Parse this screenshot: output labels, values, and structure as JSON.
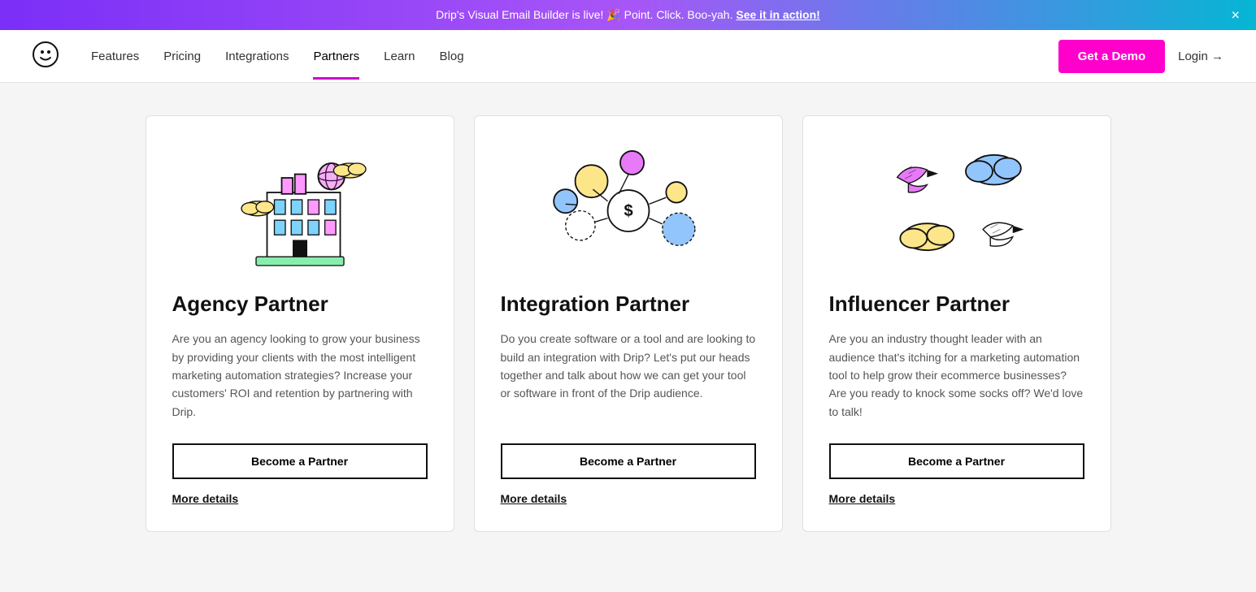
{
  "banner": {
    "text": "Drip's Visual Email Builder is live! 🎉 Point. Click. Boo-yah. ",
    "link_text": "See it in action!",
    "close_label": "×"
  },
  "nav": {
    "logo_alt": "Drip logo",
    "links": [
      {
        "label": "Features",
        "href": "#",
        "active": false
      },
      {
        "label": "Pricing",
        "href": "#",
        "active": false
      },
      {
        "label": "Integrations",
        "href": "#",
        "active": false
      },
      {
        "label": "Partners",
        "href": "#",
        "active": true
      },
      {
        "label": "Learn",
        "href": "#",
        "active": false
      },
      {
        "label": "Blog",
        "href": "#",
        "active": false
      }
    ],
    "demo_button": "Get a Demo",
    "login_link": "Login →"
  },
  "cards": [
    {
      "id": "agency",
      "title": "Agency Partner",
      "description": "Are you an agency looking to grow your business by providing your clients with the most intelligent marketing automation strategies? Increase your customers' ROI and retention by partnering with Drip.",
      "button_label": "Become a Partner",
      "more_details_label": "More details"
    },
    {
      "id": "integration",
      "title": "Integration Partner",
      "description": "Do you create software or a tool and are looking to build an integration with Drip? Let's put our heads together and talk about how we can get your tool or software in front of the Drip audience.",
      "button_label": "Become a Partner",
      "more_details_label": "More details"
    },
    {
      "id": "influencer",
      "title": "Influencer Partner",
      "description": "Are you an industry thought leader with an audience that's itching for a marketing automation tool to help grow their ecommerce businesses? Are you ready to knock some socks off? We'd love to talk!",
      "button_label": "Become a Partner",
      "more_details_label": "More details"
    }
  ]
}
